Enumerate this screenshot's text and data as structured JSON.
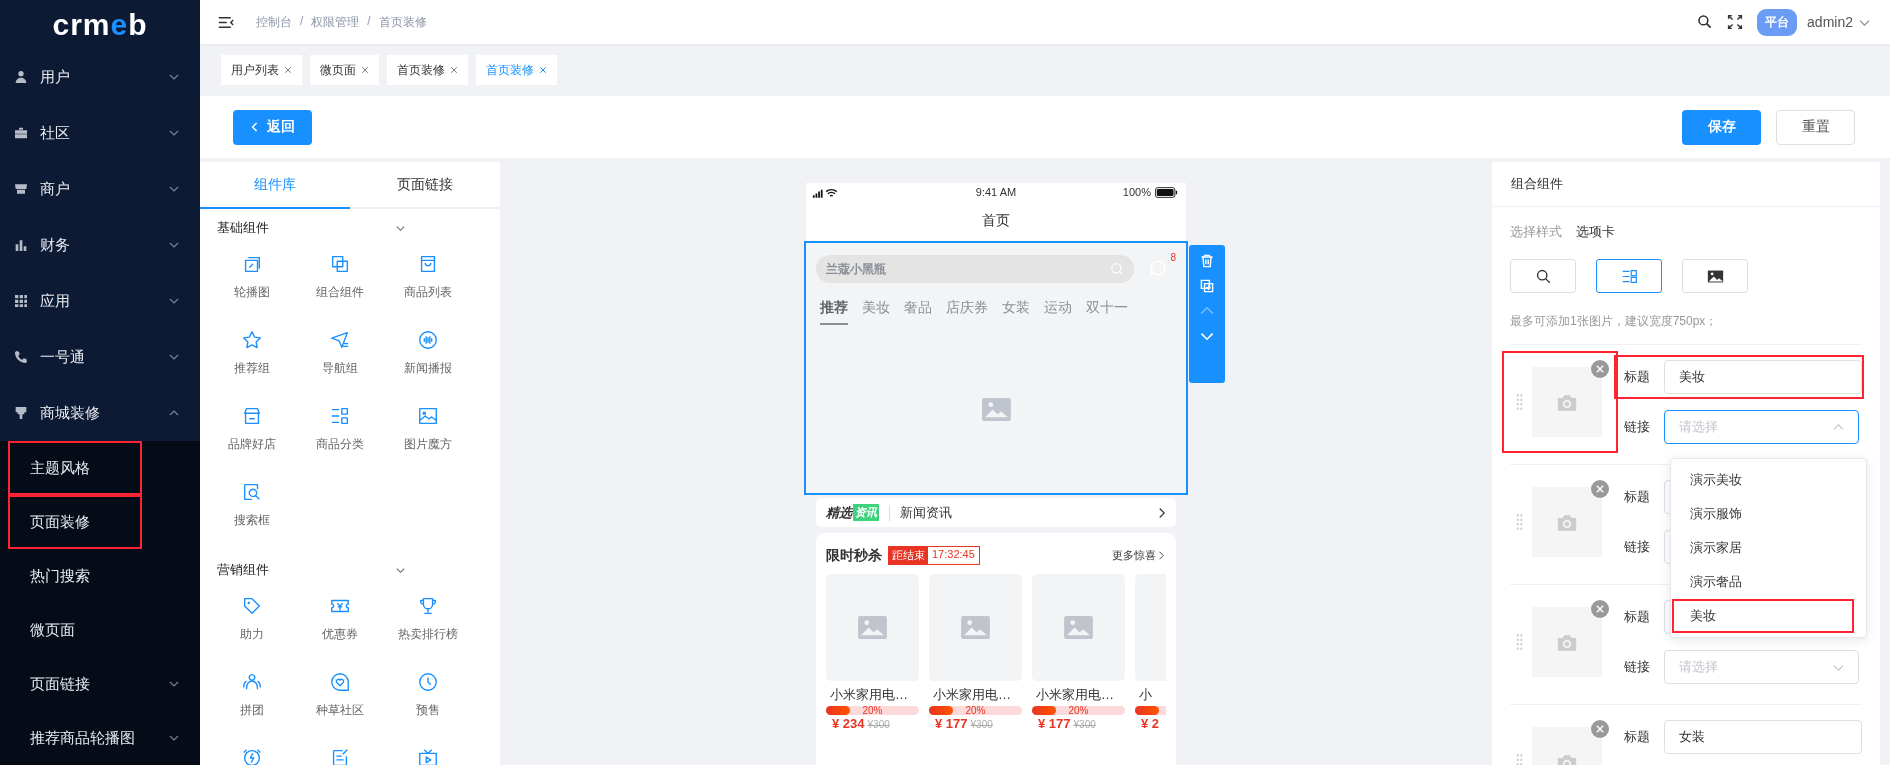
{
  "logo": "crmeb",
  "sidebar": {
    "items": [
      {
        "label": "用户",
        "expanded": false
      },
      {
        "label": "社区",
        "expanded": false
      },
      {
        "label": "商户",
        "expanded": false
      },
      {
        "label": "财务",
        "expanded": false
      },
      {
        "label": "应用",
        "expanded": false
      },
      {
        "label": "一号通",
        "expanded": false
      },
      {
        "label": "商城装修",
        "expanded": true,
        "children": [
          {
            "label": "主题风格",
            "marked": true
          },
          {
            "label": "页面装修",
            "marked": true
          },
          {
            "label": "热门搜索",
            "marked": false
          },
          {
            "label": "微页面",
            "marked": false
          },
          {
            "label": "页面链接",
            "marked": false,
            "expanded": false
          },
          {
            "label": "推荐商品轮播图",
            "marked": false,
            "expanded": false
          }
        ]
      }
    ]
  },
  "header": {
    "breadcrumb": [
      "控制台",
      "权限管理",
      "首页装修"
    ],
    "separator": "/",
    "role_badge": "平台",
    "user": "admin2"
  },
  "open_tabs": [
    {
      "label": "用户列表",
      "selected": false
    },
    {
      "label": "微页面",
      "selected": false
    },
    {
      "label": "首页装修",
      "selected": false
    },
    {
      "label": "首页装修",
      "selected": true
    }
  ],
  "actions": {
    "back": "返回",
    "save": "保存",
    "reset": "重置"
  },
  "library": {
    "tabs": [
      {
        "label": "组件库",
        "selected": true
      },
      {
        "label": "页面链接",
        "selected": false
      }
    ],
    "sections": [
      {
        "title": "基础组件",
        "expanded": true,
        "items": [
          {
            "kind": "labeled",
            "label": "轮播图"
          },
          {
            "kind": "labeled",
            "label": "组合组件"
          },
          {
            "kind": "labeled",
            "label": "商品列表"
          },
          {
            "kind": "labeled",
            "label": "推荐组"
          },
          {
            "kind": "labeled",
            "label": "导航组"
          },
          {
            "kind": "labeled",
            "label": "新闻播报"
          },
          {
            "kind": "labeled",
            "label": "品牌好店"
          },
          {
            "kind": "labeled",
            "label": "商品分类"
          },
          {
            "kind": "labeled",
            "label": "图片魔方"
          },
          {
            "kind": "labeled",
            "label": "搜索框"
          }
        ]
      },
      {
        "title": "营销组件",
        "expanded": true,
        "items": [
          {
            "kind": "labeled",
            "label": "助力"
          },
          {
            "kind": "labeled",
            "label": "优惠券"
          },
          {
            "kind": "labeled",
            "label": "热卖排行榜"
          },
          {
            "kind": "labeled",
            "label": "拼团"
          },
          {
            "kind": "labeled",
            "label": "种草社区"
          },
          {
            "kind": "labeled",
            "label": "预售"
          },
          {
            "kind": "icon-only"
          },
          {
            "kind": "icon-only"
          },
          {
            "kind": "icon-only"
          }
        ]
      }
    ]
  },
  "phone": {
    "time": "9:41 AM",
    "battery": "100%",
    "title": "首页",
    "search_placeholder": "兰蔻小黑瓶",
    "message_count": "8",
    "tabs": [
      {
        "label": "推荐",
        "selected": true
      },
      {
        "label": "美妆",
        "selected": false
      },
      {
        "label": "奢品",
        "selected": false
      },
      {
        "label": "店庆券",
        "selected": false
      },
      {
        "label": "女装",
        "selected": false
      },
      {
        "label": "运动",
        "selected": false
      },
      {
        "label": "双十一",
        "selected": false
      }
    ],
    "block_toolbar": {
      "up_disabled": true
    },
    "news": {
      "brand": "精选",
      "brand_tag": "资讯",
      "headline": "新闻资讯"
    },
    "flash_sale": {
      "title": "限时秒杀",
      "countdown_label": "距结束",
      "countdown": "17:32:45",
      "more": "更多惊喜",
      "products": [
        {
          "name": "小米家用电…",
          "percent": "20%",
          "level": 0.26,
          "price": "¥ 234",
          "old_price": "¥300"
        },
        {
          "name": "小米家用电…",
          "percent": "20%",
          "level": 0.26,
          "price": "¥ 177",
          "old_price": "¥300"
        },
        {
          "name": "小米家用电…",
          "percent": "20%",
          "level": 0.26,
          "price": "¥ 177",
          "old_price": "¥300"
        },
        {
          "name": "小",
          "level": 0.26,
          "price": "¥ 2"
        }
      ]
    }
  },
  "settings": {
    "title": "组合组件",
    "style_label": "选择样式",
    "style_value": "选项卡",
    "styles": [
      {
        "selected": false
      },
      {
        "selected": true
      },
      {
        "selected": false
      }
    ],
    "hint": "最多可添加1张图片，建议宽度750px；",
    "items": [
      {
        "title_label": "标题",
        "title": "美妆",
        "link_label": "链接",
        "link_placeholder": "请选择",
        "open": true,
        "image_marked": true,
        "title_marked": true
      },
      {
        "title_label": "标题",
        "link_label": "链接",
        "open": false,
        "image_marked": false,
        "title_marked": false
      },
      {
        "title_label": "标题",
        "link_label": "链接",
        "link_placeholder": "请选择",
        "open": false,
        "image_marked": false,
        "title_marked": false
      },
      {
        "title_label": "标题",
        "title": "女装",
        "image_marked": false,
        "title_marked": false
      }
    ],
    "dropdown": {
      "options": [
        {
          "label": "演示美妆",
          "marked": false
        },
        {
          "label": "演示服饰",
          "marked": false
        },
        {
          "label": "演示家居",
          "marked": false
        },
        {
          "label": "演示奢品",
          "marked": false
        },
        {
          "label": "美妆",
          "marked": true
        }
      ]
    }
  }
}
